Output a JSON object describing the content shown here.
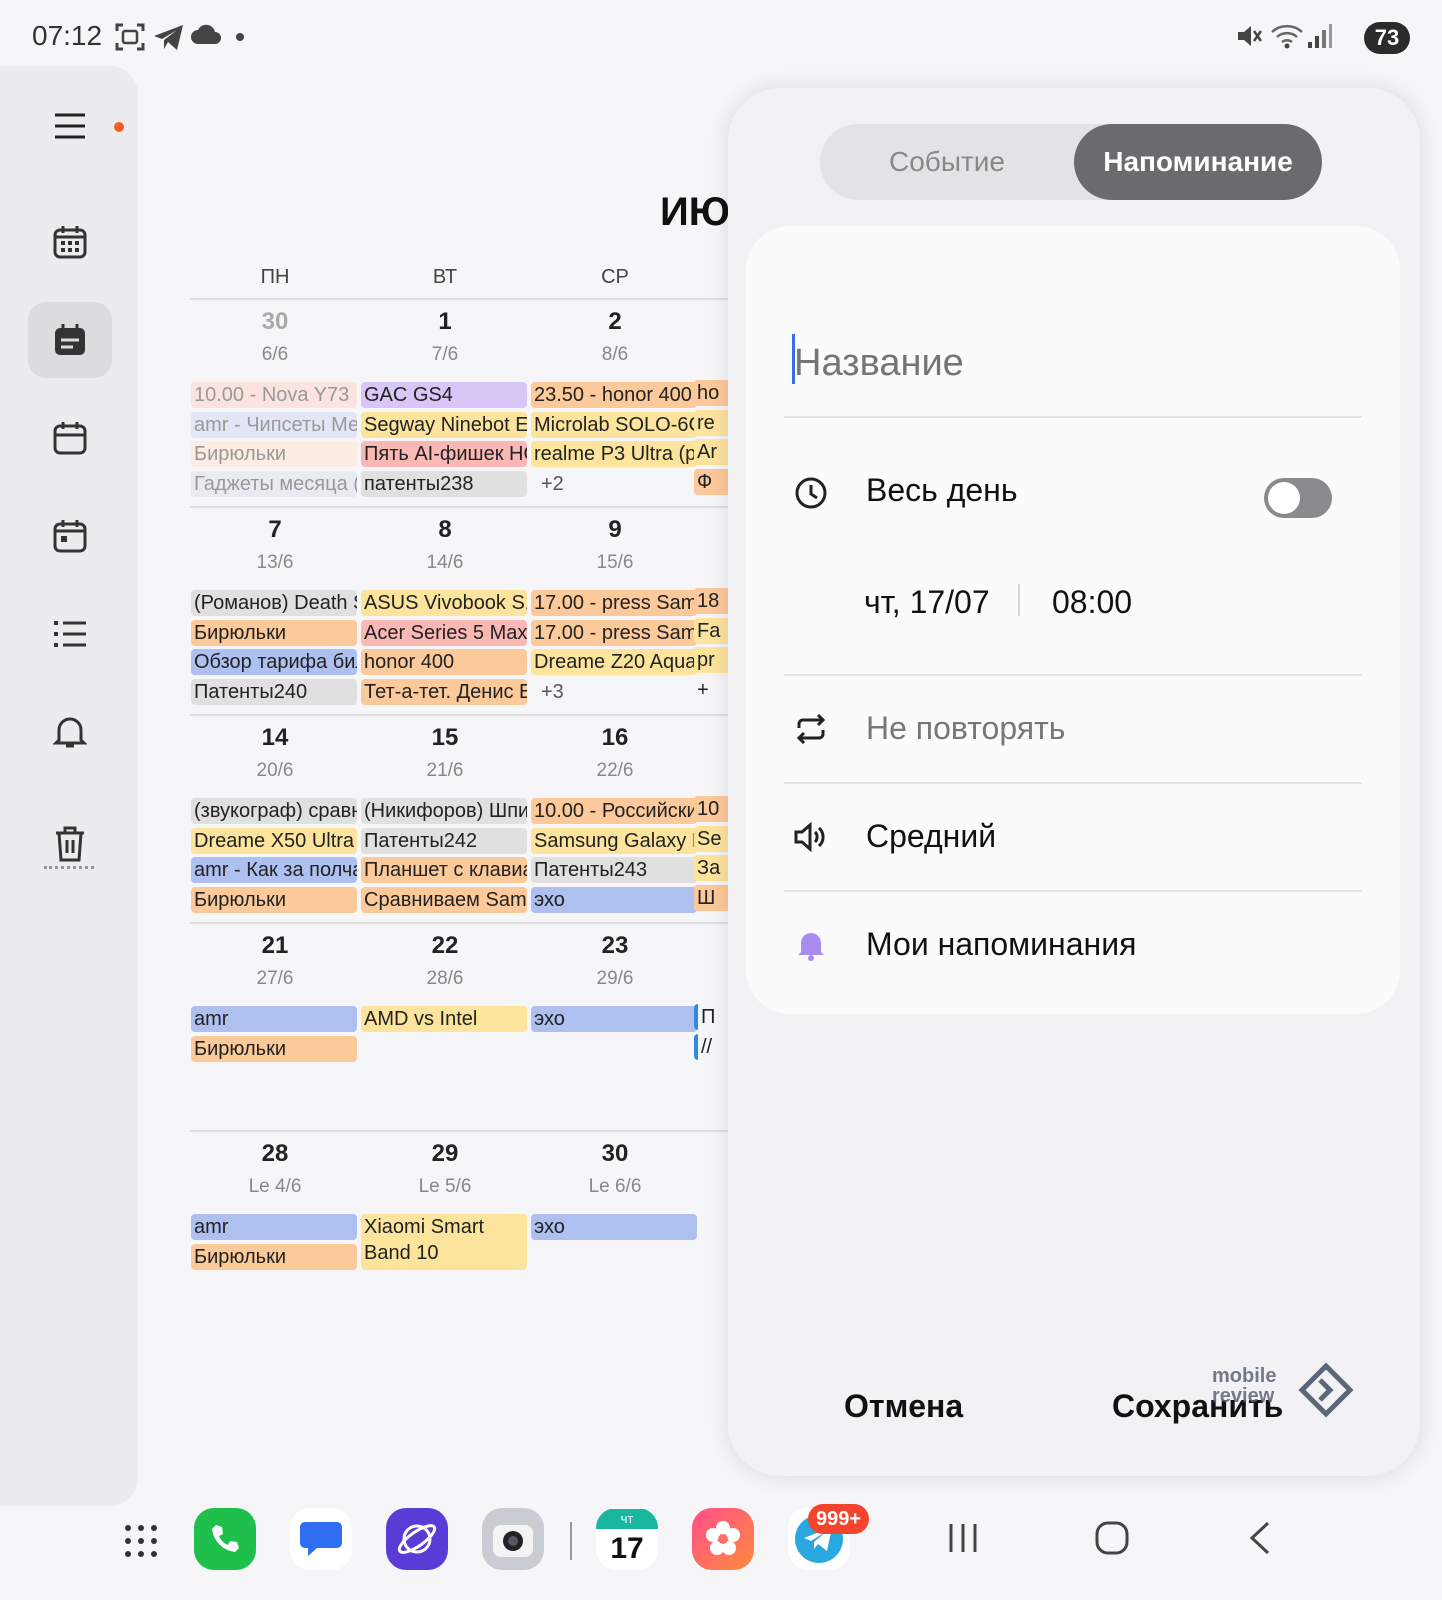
{
  "status_bar": {
    "time": "07:12",
    "battery": "73"
  },
  "calendar": {
    "month_title": "ИЮ",
    "weekdays": [
      "ПН",
      "ВТ",
      "СР"
    ],
    "weeks": [
      {
        "days": [
          {
            "num": "30",
            "lunar": "6/6",
            "dim": true,
            "events": [
              {
                "text": "10.00 - Nova Y73",
                "color": "#fbe3df",
                "faded": true
              },
              {
                "text": "amr - Чипсеты Ме",
                "color": "#e3e7f5",
                "faded": true
              },
              {
                "text": "Бирюльки",
                "color": "#fdece3",
                "faded": true
              },
              {
                "text": "Гаджеты месяца (",
                "color": "#e9ebf2",
                "faded": true
              }
            ]
          },
          {
            "num": "1",
            "lunar": "7/6",
            "events": [
              {
                "text": "GAC GS4",
                "color": "#d7c6f6"
              },
              {
                "text": "Segway Ninebot E",
                "color": "#fde49d"
              },
              {
                "text": "Пять AI-фишек HO",
                "color": "#f9b8b3"
              },
              {
                "text": "патенты238",
                "color": "#e0e0e0"
              }
            ]
          },
          {
            "num": "2",
            "lunar": "8/6",
            "events": [
              {
                "text": "23.50 - honor 400",
                "color": "#fcc99a"
              },
              {
                "text": "Microlab SOLO-6C",
                "color": "#fde49d"
              },
              {
                "text": "realme P3 Ultra (p",
                "color": "#fde49d"
              },
              {
                "text": "+2",
                "more": true
              }
            ]
          }
        ]
      },
      {
        "days": [
          {
            "num": "7",
            "lunar": "13/6",
            "events": [
              {
                "text": "(Романов) Death S",
                "color": "#e0e0e0"
              },
              {
                "text": "Бирюльки",
                "color": "#fcc99a"
              },
              {
                "text": "Обзор тарифа бил",
                "color": "#aec0f0"
              },
              {
                "text": "Патенты240",
                "color": "#e0e0e0"
              }
            ]
          },
          {
            "num": "8",
            "lunar": "14/6",
            "events": [
              {
                "text": "ASUS Vivobook S1",
                "color": "#fde49d"
              },
              {
                "text": "Acer Series 5 Max",
                "color": "#f9b8b3"
              },
              {
                "text": "honor 400",
                "color": "#fcc99a"
              },
              {
                "text": "Тет-а-тет. Денис Е",
                "color": "#fcc99a"
              }
            ]
          },
          {
            "num": "9",
            "lunar": "15/6",
            "events": [
              {
                "text": "17.00 - press Sams",
                "color": "#fcc99a"
              },
              {
                "text": "17.00 - press Sams",
                "color": "#fcc99a"
              },
              {
                "text": "Dreame Z20 Aqua",
                "color": "#fde49d"
              },
              {
                "text": "+3",
                "more": true
              }
            ]
          }
        ]
      },
      {
        "days": [
          {
            "num": "14",
            "lunar": "20/6",
            "events": [
              {
                "text": "(звукограф) сравн",
                "color": "#e0e0e0"
              },
              {
                "text": "Dreame X50 Ultra",
                "color": "#fde49d"
              },
              {
                "text": "amr - Как за полча",
                "color": "#aec0f0"
              },
              {
                "text": "Бирюльки",
                "color": "#fcc99a"
              }
            ]
          },
          {
            "num": "15",
            "lunar": "21/6",
            "events": [
              {
                "text": "(Никифоров) Шпи",
                "color": "#e0e0e0"
              },
              {
                "text": "Патенты242",
                "color": "#e0e0e0"
              },
              {
                "text": "Планшет с клавиа",
                "color": "#fcc99a"
              },
              {
                "text": "Сравниваем Sams",
                "color": "#fcc99a"
              }
            ]
          },
          {
            "num": "16",
            "lunar": "22/6",
            "events": [
              {
                "text": "10.00 - Российски",
                "color": "#fcc99a"
              },
              {
                "text": "Samsung Galaxy E",
                "color": "#fde49d"
              },
              {
                "text": "Патенты243",
                "color": "#e0e0e0"
              },
              {
                "text": "эхо",
                "color": "#aec0f0"
              }
            ]
          }
        ]
      },
      {
        "days": [
          {
            "num": "21",
            "lunar": "27/6",
            "events": [
              {
                "text": "amr",
                "color": "#aec0f0"
              },
              {
                "text": "Бирюльки",
                "color": "#fcc99a"
              }
            ]
          },
          {
            "num": "22",
            "lunar": "28/6",
            "events": [
              {
                "text": "AMD vs Intel",
                "color": "#fde49d"
              }
            ]
          },
          {
            "num": "23",
            "lunar": "29/6",
            "events": [
              {
                "text": "эхо",
                "color": "#aec0f0"
              }
            ]
          }
        ]
      },
      {
        "days": [
          {
            "num": "28",
            "lunar": "Le 4/6",
            "events": [
              {
                "text": "amr",
                "color": "#aec0f0"
              },
              {
                "text": "Бирюльки",
                "color": "#fcc99a"
              }
            ]
          },
          {
            "num": "29",
            "lunar": "Le 5/6",
            "events": [
              {
                "text": "Xiaomi Smart Band 10",
                "color": "#fde49d",
                "tall": true
              }
            ]
          },
          {
            "num": "30",
            "lunar": "Le 6/6",
            "events": [
              {
                "text": "эхо",
                "color": "#aec0f0"
              }
            ]
          }
        ]
      }
    ],
    "cut_column": [
      [
        "ho",
        "re",
        "Ar",
        "Ф"
      ],
      [
        "18",
        "Fa",
        "pr",
        "+"
      ],
      [
        "10",
        "Se",
        "За",
        "Ш"
      ],
      [
        "П",
        "//"
      ]
    ]
  },
  "sheet": {
    "tabs": {
      "event": "Событие",
      "reminder": "Напоминание"
    },
    "title_placeholder": "Название",
    "all_day_label": "Весь день",
    "all_day_on": false,
    "date": "чт, 17/07",
    "time": "08:00",
    "repeat_label": "Не повторять",
    "priority_label": "Средний",
    "list_label": "Мои напоминания",
    "cancel_label": "Отмена",
    "save_label": "Сохранить"
  },
  "watermark": {
    "line1": "mobile",
    "line2": "review"
  },
  "dock": {
    "calendar_app": {
      "weekday": "чт",
      "day": "17"
    },
    "telegram_badge": "999+"
  },
  "colors": {
    "accent_caret": "#3a6fe0",
    "segment_active": "#6b6b6e",
    "notification_dot": "#f06022",
    "reminder_bell": "#a98cf0"
  }
}
